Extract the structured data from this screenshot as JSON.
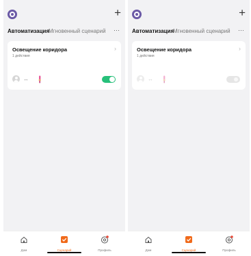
{
  "screens": [
    {
      "header": {
        "add_label": "+"
      },
      "tabs": {
        "automation": "Автоматизация",
        "instant": "Мгновенный сценарий",
        "more": "···"
      },
      "card": {
        "title": "Освещение коридора",
        "subtitle": "1 действия",
        "chevron": "›",
        "arrow": "↔",
        "toggle_state": "on"
      },
      "tabbar": {
        "home": "Дом",
        "scenes": "Сценарий",
        "profile": "Профиль"
      }
    },
    {
      "header": {
        "add_label": "+"
      },
      "tabs": {
        "automation": "Автоматизация",
        "instant": "Мгновенный сценарий",
        "more": "···"
      },
      "card": {
        "title": "Освещение коридора",
        "subtitle": "1 действия",
        "chevron": "›",
        "arrow": "↔",
        "toggle_state": "off"
      },
      "tabbar": {
        "home": "Дом",
        "scenes": "Сценарий",
        "profile": "Профиль"
      }
    }
  ],
  "colors": {
    "accent_green": "#27c07a",
    "accent_orange": "#f06a1b",
    "avatar_purple": "#6b5aa6"
  }
}
